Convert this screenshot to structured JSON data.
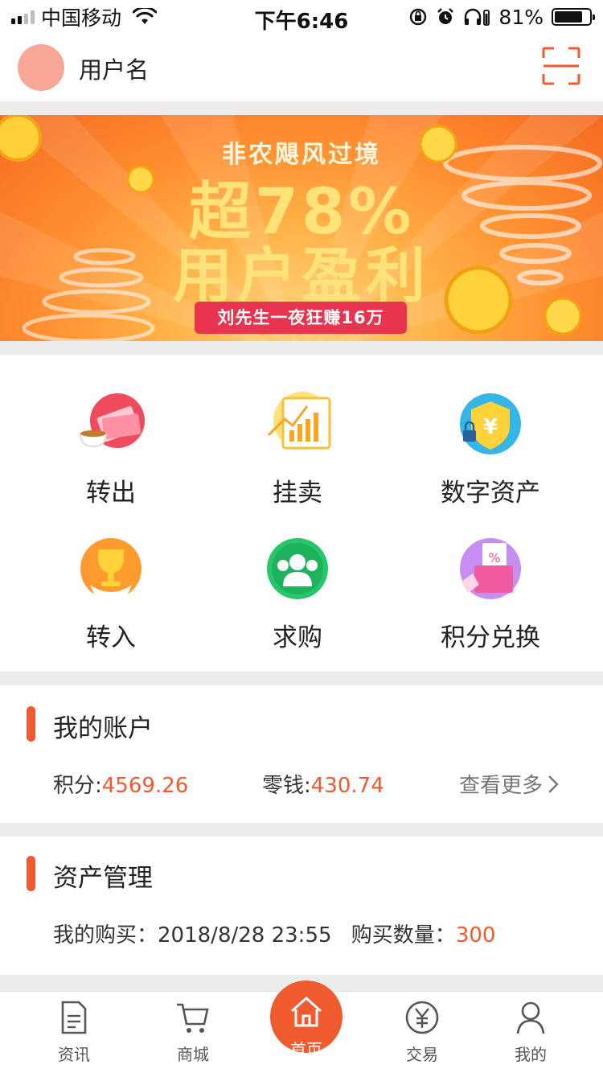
{
  "status_bar": {
    "carrier": "中国移动",
    "time": "下午6:46",
    "battery_percent": "81%",
    "battery_level": 0.81
  },
  "header": {
    "username": "用户名"
  },
  "banner": {
    "title": "非农飓风过境",
    "line1": "超78%",
    "line2": "用户盈利",
    "ribbon": "刘先生一夜狂赚16万"
  },
  "menu": [
    {
      "label": "转出",
      "icon": "transfer-out-icon"
    },
    {
      "label": "挂卖",
      "icon": "sell-listing-icon"
    },
    {
      "label": "数字资产",
      "icon": "digital-asset-icon"
    },
    {
      "label": "转入",
      "icon": "transfer-in-icon"
    },
    {
      "label": "求购",
      "icon": "buy-request-icon"
    },
    {
      "label": "积分兑换",
      "icon": "points-exchange-icon"
    }
  ],
  "account": {
    "title": "我的账户",
    "points_label": "积分:",
    "points_value": "4569.26",
    "change_label": "零钱:",
    "change_value": "430.74",
    "more_label": "查看更多"
  },
  "asset": {
    "title": "资产管理",
    "purchase_label": "我的购买：",
    "purchase_time": "2018/8/28 23:55",
    "quantity_label": "购买数量：",
    "quantity_value": "300"
  },
  "tabs": [
    {
      "label": "资讯",
      "icon": "news-icon"
    },
    {
      "label": "商城",
      "icon": "cart-icon"
    },
    {
      "label": "首页",
      "icon": "home-icon"
    },
    {
      "label": "交易",
      "icon": "yuan-icon"
    },
    {
      "label": "我的",
      "icon": "user-icon"
    }
  ],
  "colors": {
    "accent": "#ef5a2e",
    "avatar": "#f8a696",
    "divider": "#ececec"
  }
}
